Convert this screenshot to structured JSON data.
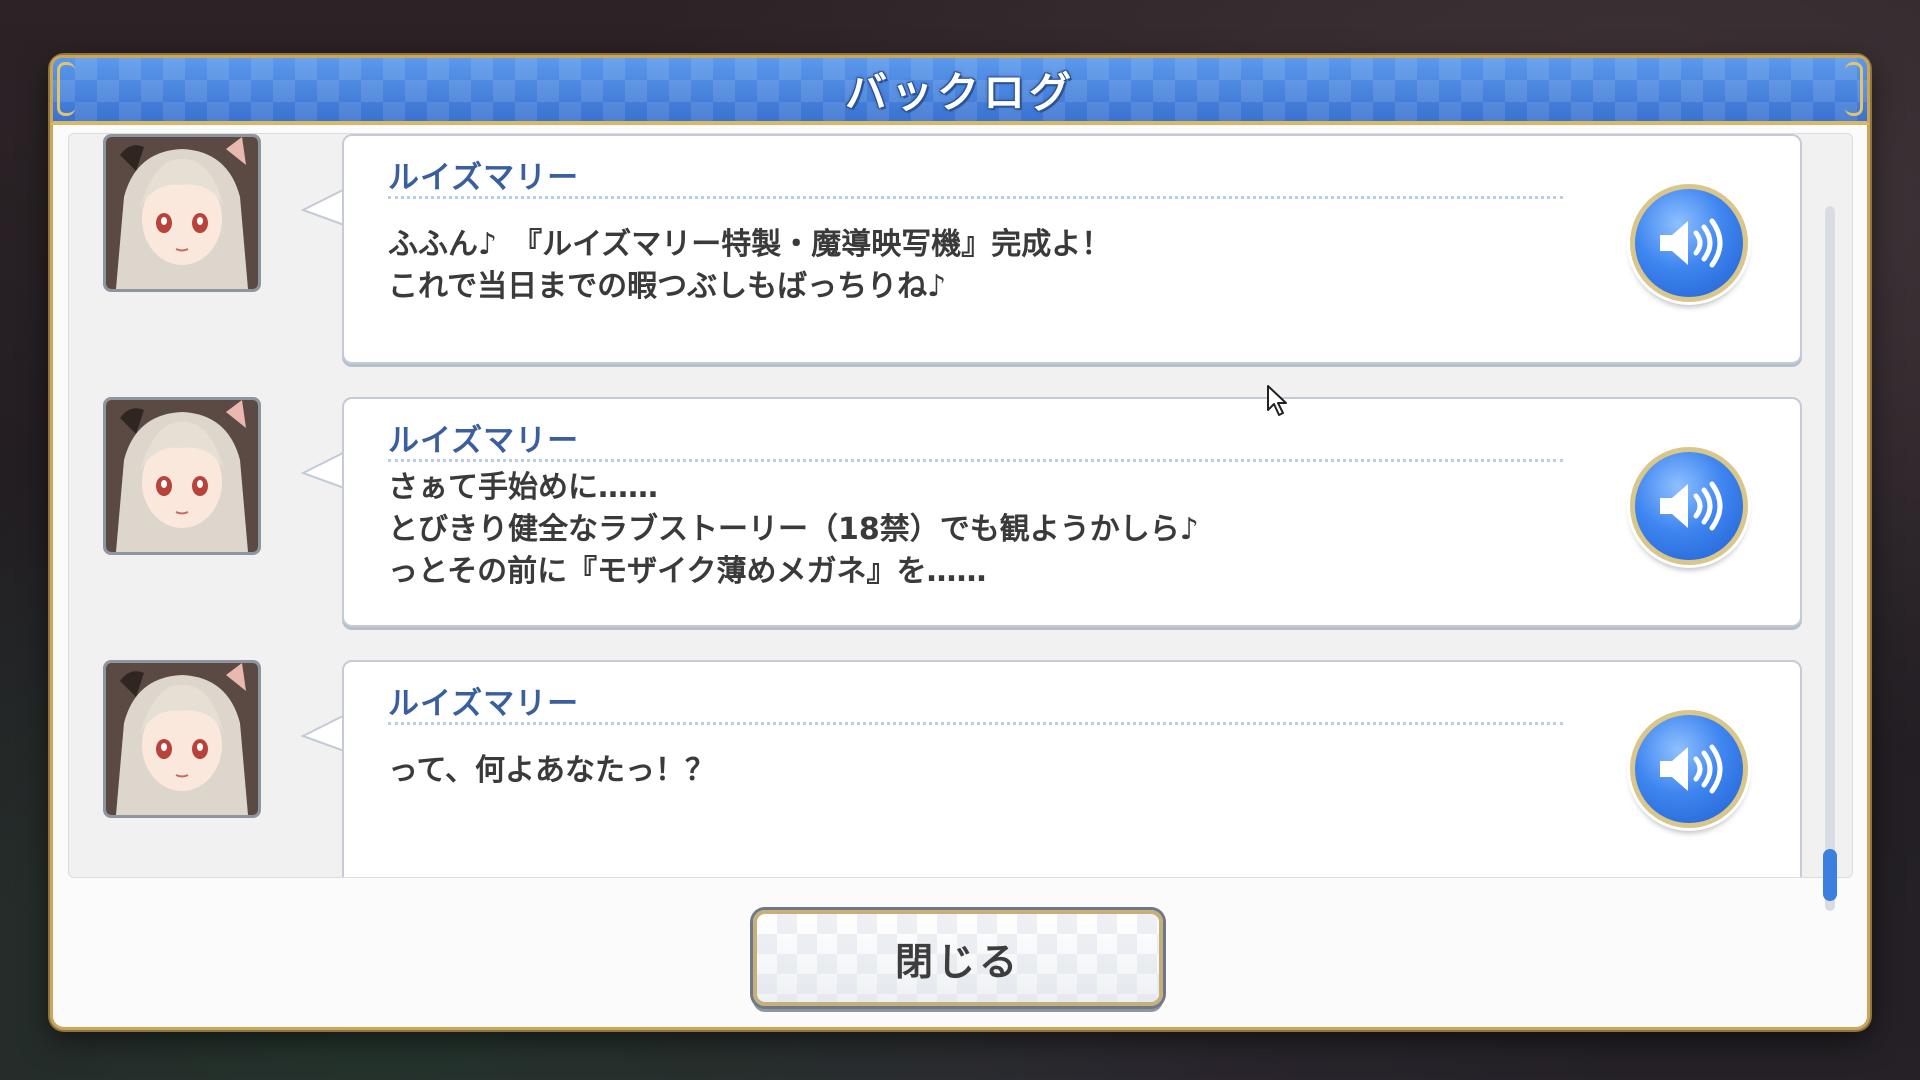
{
  "dialog": {
    "title": "バックログ",
    "close_label": "閉じる"
  },
  "log": [
    {
      "speaker": "ルイズマリー",
      "lines": [
        "ふふん♪　『ルイズマリー特製・魔導映写機』完成よ！",
        "これで当日までの暇つぶしもばっちりね♪"
      ],
      "portrait_icon": "character-portrait-icon",
      "voice_icon": "speaker-icon"
    },
    {
      "speaker": "ルイズマリー",
      "lines": [
        "さぁて手始めに……",
        "とびきり健全なラブストーリー（18禁）でも観ようかしら♪",
        "っとその前に『モザイク薄めメガネ』を……"
      ],
      "portrait_icon": "character-portrait-icon",
      "voice_icon": "speaker-icon"
    },
    {
      "speaker": "ルイズマリー",
      "lines": [
        "",
        "って、何よあなたっ！？"
      ],
      "portrait_icon": "character-portrait-icon",
      "voice_icon": "speaker-icon"
    }
  ],
  "scroll": {
    "position": 1.0
  },
  "colors": {
    "header_blue": "#3f7ed8",
    "gold_border": "#c9a65a",
    "speaker_name": "#3a5f9e",
    "voice_button": "#3f86f0"
  }
}
